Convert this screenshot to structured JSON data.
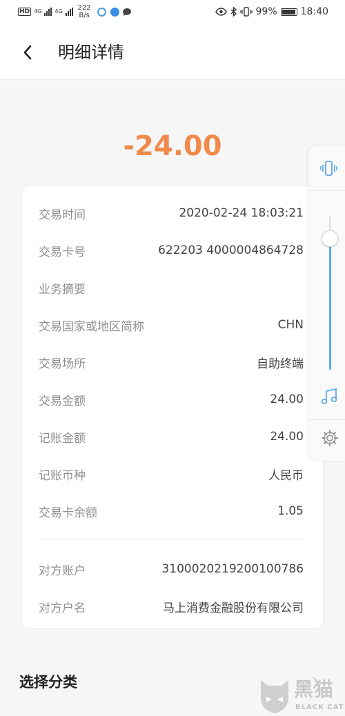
{
  "status_bar": {
    "hd": "HD",
    "net1": "4G",
    "net2": "4G",
    "speed_value": "222",
    "speed_unit": "B/s",
    "battery": "99%",
    "time": "18:40"
  },
  "header": {
    "title": "明细详情"
  },
  "amount": "-24.00",
  "details": [
    {
      "label": "交易时间",
      "value": "2020-02-24 18:03:21"
    },
    {
      "label": "交易卡号",
      "value": "622203 4000004864728"
    },
    {
      "label": "业务摘要",
      "value": ""
    },
    {
      "label": "交易国家或地区简称",
      "value": "CHN"
    },
    {
      "label": "交易场所",
      "value": "自助终端"
    },
    {
      "label": "交易金额",
      "value": "24.00"
    },
    {
      "label": "记账金额",
      "value": "24.00"
    },
    {
      "label": "记账币种",
      "value": "人民币"
    },
    {
      "label": "交易卡余额",
      "value": "1.05"
    }
  ],
  "counterparty": [
    {
      "label": "对方账户",
      "value": "310002021920010078​6"
    },
    {
      "label": "对方户名",
      "value": "马上消费金融股份有限公司"
    }
  ],
  "section": {
    "title": "选择分类"
  },
  "side_panel": {
    "volume_level": 0.85
  },
  "watermark": {
    "cn": "黑猫",
    "en": "BLACK CAT"
  },
  "colors": {
    "amount": "#f08a4b",
    "accent_blue": "#5ea8e8"
  }
}
